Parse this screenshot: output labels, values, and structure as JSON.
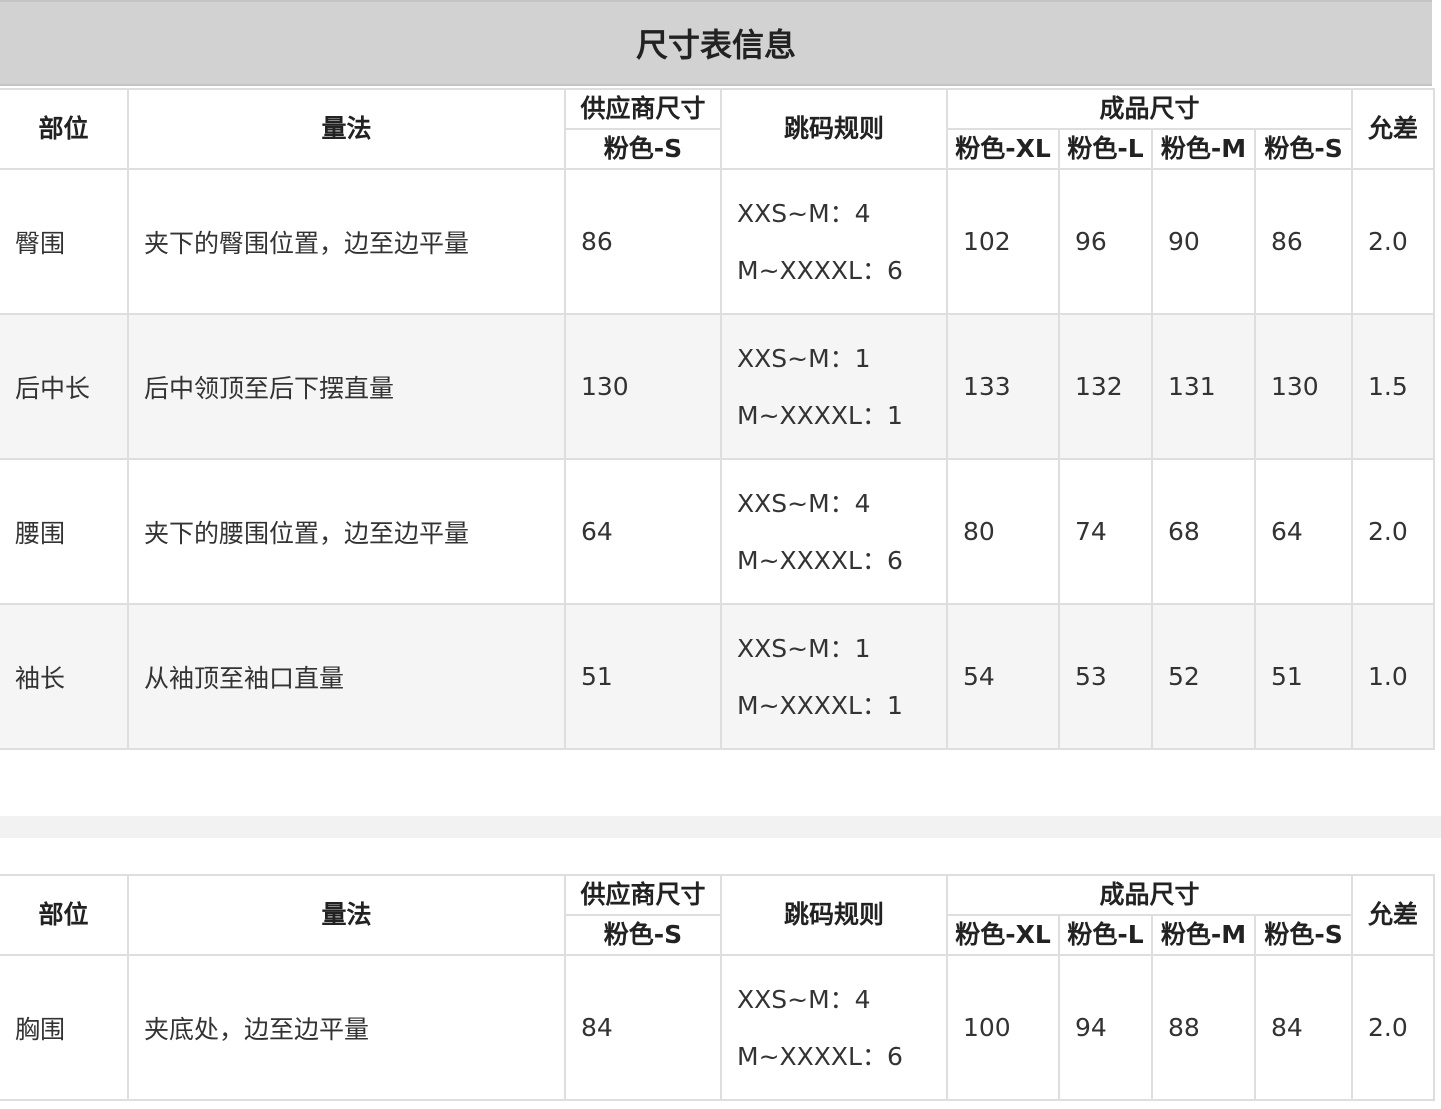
{
  "title": "尺寸表信息",
  "headers": {
    "part": "部位",
    "method": "量法",
    "supplier_size": "供应商尺寸",
    "supplier_sub": "粉色-S",
    "jump_rule": "跳码规则",
    "finished_size": "成品尺寸",
    "size_xl": "粉色-XL",
    "size_l": "粉色-L",
    "size_m": "粉色-M",
    "size_s": "粉色-S",
    "tolerance": "允差"
  },
  "table1": {
    "rows": [
      {
        "part": "臀围",
        "method": "夹下的臀围位置，边至边平量",
        "supplier": "86",
        "rule1": "XXS~M：4",
        "rule2": "M~XXXXL：6",
        "xl": "102",
        "l": "96",
        "m": "90",
        "s": "86",
        "tolerance": "2.0"
      },
      {
        "part": "后中长",
        "method": "后中领顶至后下摆直量",
        "supplier": "130",
        "rule1": "XXS~M：1",
        "rule2": "M~XXXXL：1",
        "xl": "133",
        "l": "132",
        "m": "131",
        "s": "130",
        "tolerance": "1.5"
      },
      {
        "part": "腰围",
        "method": "夹下的腰围位置，边至边平量",
        "supplier": "64",
        "rule1": "XXS~M：4",
        "rule2": "M~XXXXL：6",
        "xl": "80",
        "l": "74",
        "m": "68",
        "s": "64",
        "tolerance": "2.0"
      },
      {
        "part": "袖长",
        "method": "从袖顶至袖口直量",
        "supplier": "51",
        "rule1": "XXS~M：1",
        "rule2": "M~XXXXL：1",
        "xl": "54",
        "l": "53",
        "m": "52",
        "s": "51",
        "tolerance": "1.0"
      }
    ]
  },
  "table2": {
    "rows": [
      {
        "part": "胸围",
        "method": "夹底处，边至边平量",
        "supplier": "84",
        "rule1": "XXS~M：4",
        "rule2": "M~XXXXL：6",
        "xl": "100",
        "l": "94",
        "m": "88",
        "s": "84",
        "tolerance": "2.0"
      }
    ]
  }
}
